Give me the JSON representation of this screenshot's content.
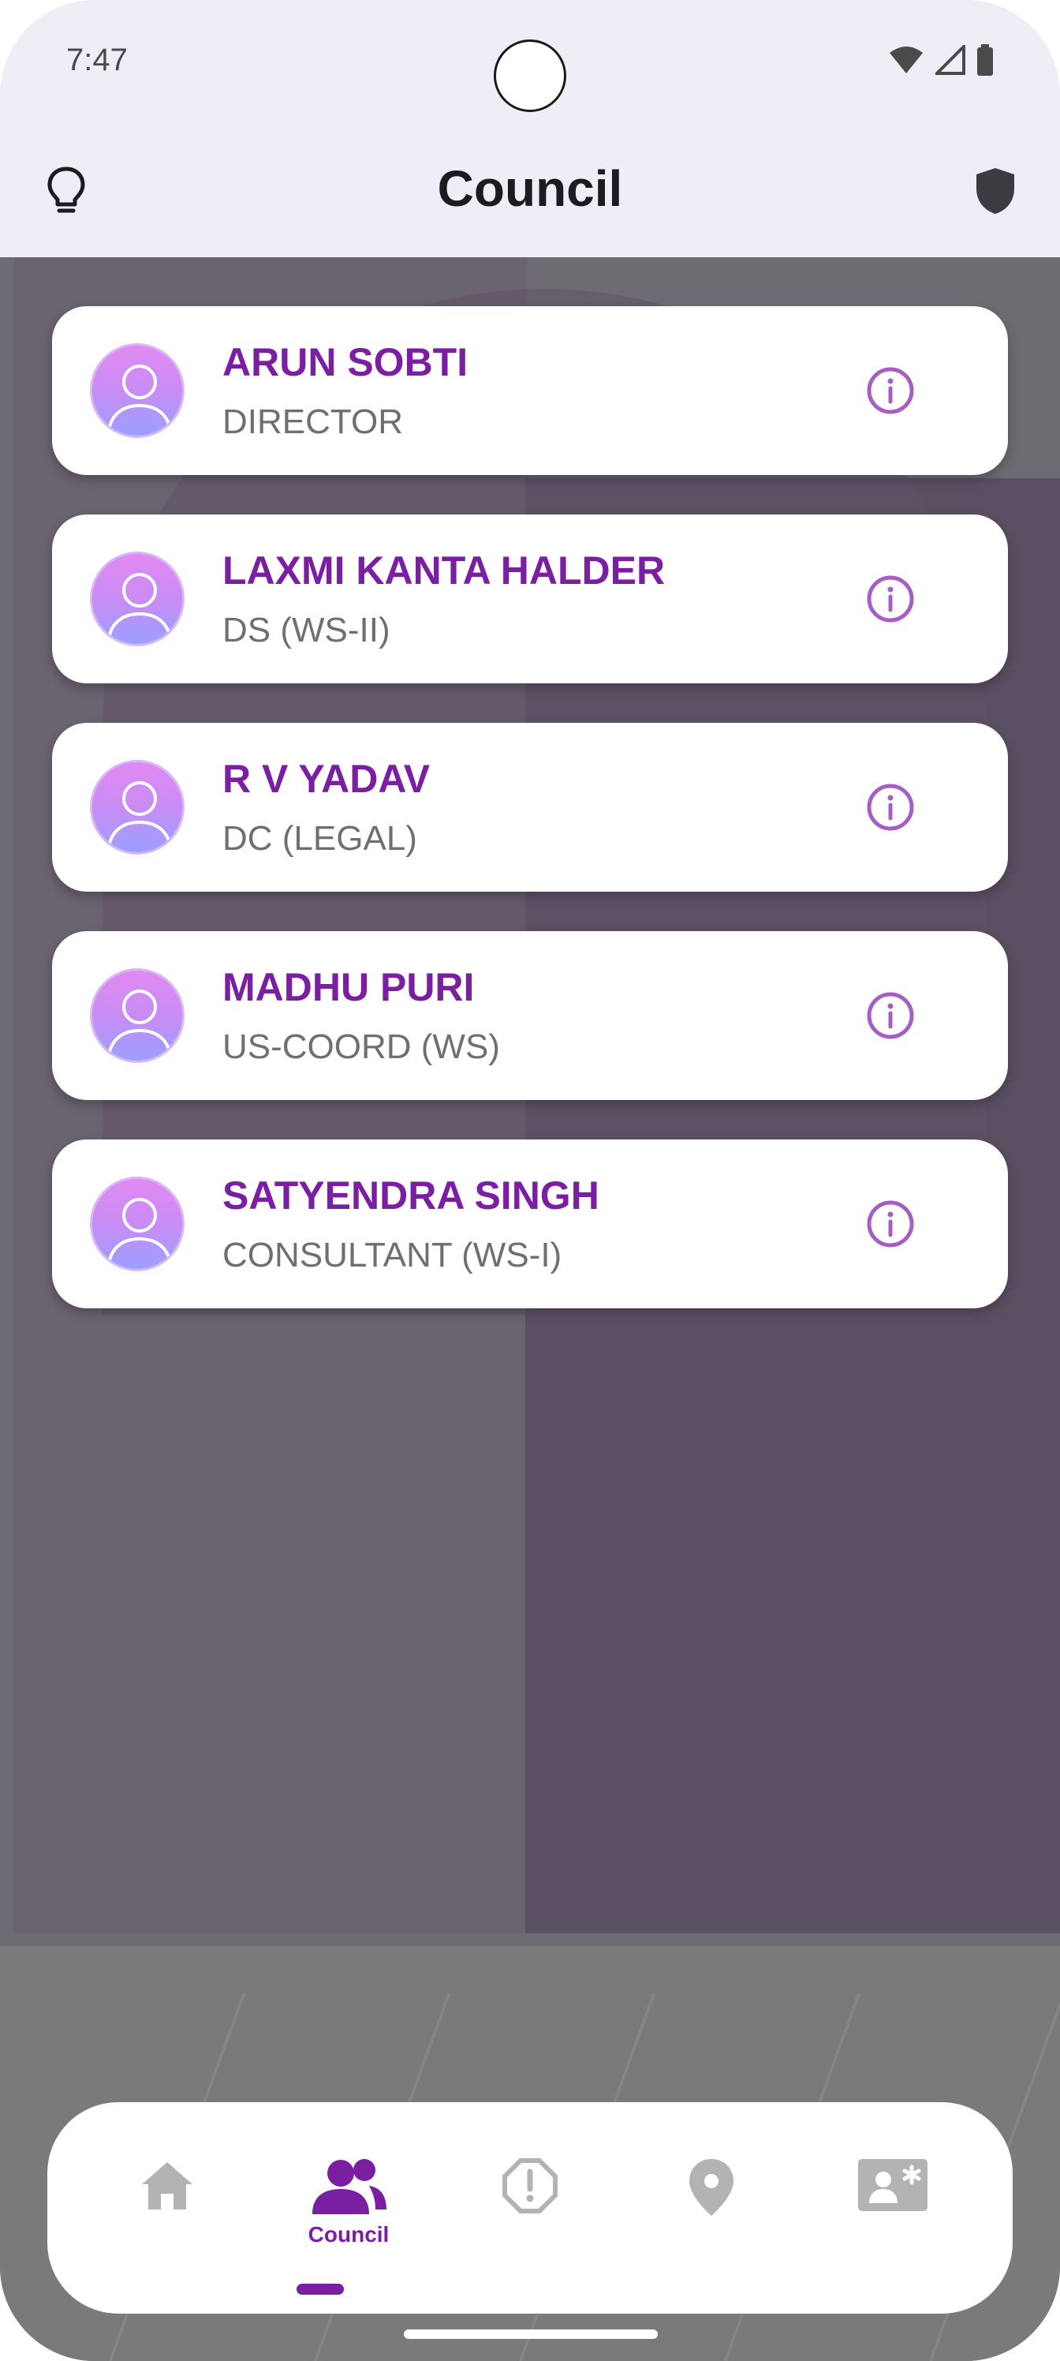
{
  "status_bar": {
    "time": "7:47",
    "icons": [
      "wifi-icon",
      "signal-icon",
      "battery-icon"
    ]
  },
  "header": {
    "title": "Council",
    "left_icon": "lightbulb-icon",
    "right_icon": "shield-icon"
  },
  "members": [
    {
      "name": "ARUN SOBTI",
      "role": "DIRECTOR"
    },
    {
      "name": "LAXMI KANTA HALDER",
      "role": "DS (WS-II)"
    },
    {
      "name": "R V YADAV",
      "role": "DC (LEGAL)"
    },
    {
      "name": "MADHU PURI",
      "role": "US-COORD (WS)"
    },
    {
      "name": "SATYENDRA SINGH",
      "role": "CONSULTANT (WS-I)"
    }
  ],
  "bottom_nav": {
    "items": [
      {
        "icon": "home-icon",
        "label": ""
      },
      {
        "icon": "people-icon",
        "label": "Council"
      },
      {
        "icon": "alert-octagon-icon",
        "label": ""
      },
      {
        "icon": "location-pin-icon",
        "label": ""
      },
      {
        "icon": "contact-card-icon",
        "label": ""
      }
    ],
    "active_index": 1
  },
  "colors": {
    "accent": "#7b1fa2",
    "inactive_icon": "#b3b3b3",
    "header_bg": "#efeef6",
    "role_text": "#6f6f6f"
  }
}
